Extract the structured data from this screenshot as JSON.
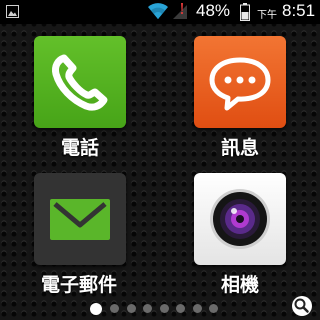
{
  "status_bar": {
    "battery_percent": "48%",
    "ampm": "下午",
    "time": "8:51",
    "icons": [
      "gallery-icon",
      "wifi-icon",
      "signal-icon",
      "battery-icon"
    ]
  },
  "apps": [
    {
      "label": "電話",
      "icon": "phone-icon",
      "color": "#55b320"
    },
    {
      "label": "訊息",
      "icon": "chat-bubble-icon",
      "color": "#ea5f22"
    },
    {
      "label": "電子郵件",
      "icon": "envelope-icon",
      "color": "#333333"
    },
    {
      "label": "相機",
      "icon": "camera-lens-icon",
      "color": "#f4f4f4"
    }
  ],
  "pager": {
    "count": 8,
    "active": 0
  },
  "zoom_icon": "magnifier-icon"
}
